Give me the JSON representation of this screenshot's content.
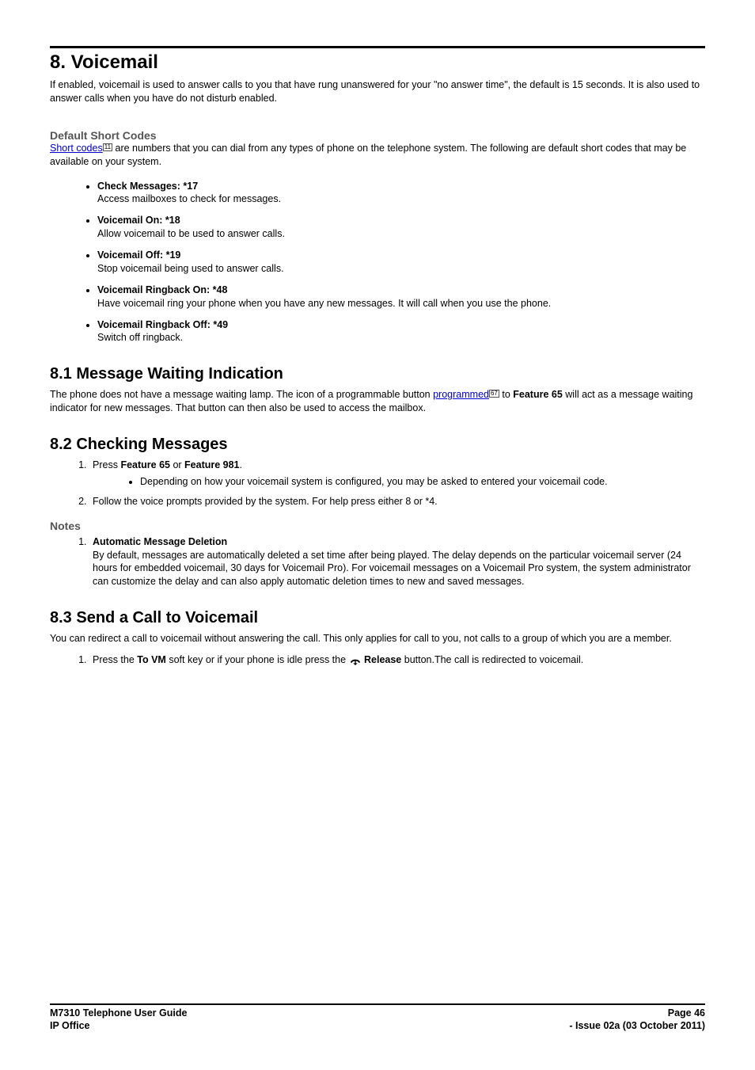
{
  "chapter": {
    "title": "8. Voicemail",
    "intro": "If enabled, voicemail is used to answer calls to you that have rung unanswered for your \"no answer time\", the default is 15 seconds. It is also used to answer calls when you have do not disturb enabled."
  },
  "shortcodes": {
    "heading": "Default Short Codes",
    "link_text": "Short codes",
    "ref": "11",
    "description": " are numbers that you can dial from any types of phone on the telephone system. The following are default short codes that may be available on your system.",
    "items": [
      {
        "title": "Check Messages: *17",
        "desc": "Access mailboxes to check for messages."
      },
      {
        "title": "Voicemail On: *18",
        "desc": "Allow voicemail to be used to answer calls."
      },
      {
        "title": "Voicemail Off: *19",
        "desc": "Stop voicemail being used to answer calls."
      },
      {
        "title": "Voicemail Ringback On: *48",
        "desc": "Have voicemail ring your phone when you have any new messages. It will call when you use the phone."
      },
      {
        "title": "Voicemail Ringback Off: *49",
        "desc": "Switch off ringback."
      }
    ]
  },
  "sec81": {
    "heading": "8.1 Message Waiting Indication",
    "text_pre": "The phone does not have a message waiting lamp. The icon of a programmable button ",
    "link": "programmed",
    "ref": "67",
    "text_mid": " to ",
    "feature": "Feature 65",
    "text_post": " will act as a message waiting indicator for new messages. That button can then also be used to access the mailbox."
  },
  "sec82": {
    "heading": "8.2 Checking Messages",
    "step1_pre": "Press ",
    "step1_b1": "Feature 65",
    "step1_mid": " or ",
    "step1_b2": "Feature 981",
    "step1_post": ".",
    "sub1": "Depending on how your voicemail system is configured, you may be asked to entered your voicemail code.",
    "step2": "Follow the voice prompts provided by the system. For help press either 8 or *4.",
    "notes_heading": "Notes",
    "note1_title": "Automatic Message Deletion",
    "note1_text": "By default, messages are automatically deleted a set time after being played. The delay depends on the particular voicemail server (24 hours for embedded voicemail, 30 days for Voicemail Pro). For voicemail messages on a Voicemail Pro system, the system administrator can customize the delay and can also apply automatic deletion times to new and saved messages."
  },
  "sec83": {
    "heading": "8.3 Send a Call to Voicemail",
    "intro": "You can redirect a call to voicemail without answering the call. This only applies for call to you, not calls to a group of which you are a member.",
    "step1_pre": "Press the ",
    "step1_b1": "To VM",
    "step1_mid": " soft key or if your phone is idle press the ",
    "step1_b2": " Release",
    "step1_post": " button.The call is redirected to voicemail."
  },
  "footer": {
    "left1": "M7310 Telephone User Guide",
    "left2": "IP Office",
    "right1": "Page 46",
    "right2": "- Issue 02a (03 October 2011)"
  }
}
